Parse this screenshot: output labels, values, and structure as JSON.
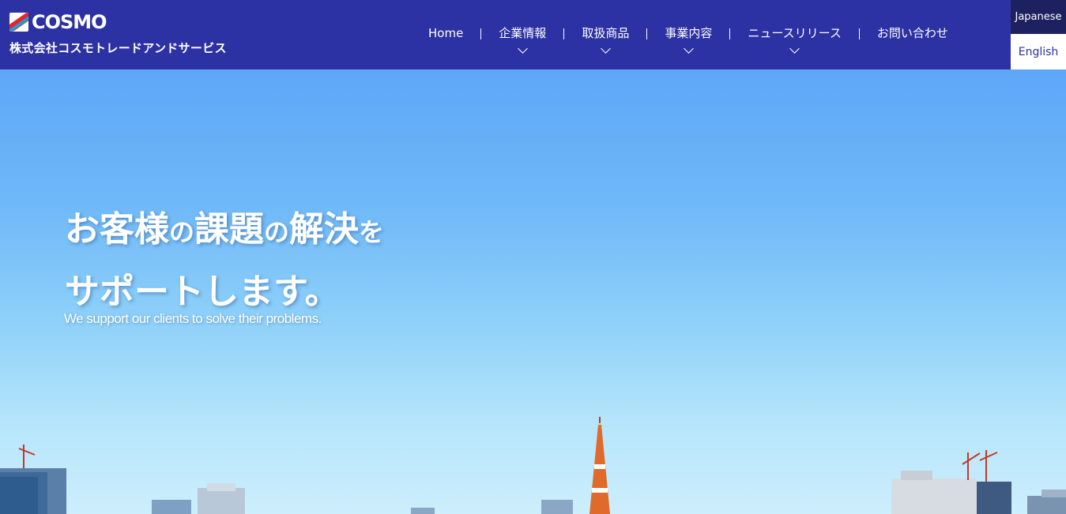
{
  "header": {
    "logo_text": "COSMO",
    "company_name": "株式会社コスモトレードアンドサービス",
    "brand_color": "#2c31a3"
  },
  "nav": {
    "items": [
      {
        "label": "Home",
        "has_dropdown": false
      },
      {
        "label": "企業情報",
        "has_dropdown": true
      },
      {
        "label": "取扱商品",
        "has_dropdown": true
      },
      {
        "label": "事業内容",
        "has_dropdown": true
      },
      {
        "label": "ニュースリリース",
        "has_dropdown": true
      },
      {
        "label": "お問い合わせ",
        "has_dropdown": false
      }
    ]
  },
  "language": {
    "japanese": "Japanese",
    "english": "English"
  },
  "hero": {
    "line1_parts": [
      "お客様",
      "の",
      "課題",
      "の",
      "解決",
      "を"
    ],
    "line2": "サポートします。",
    "subtitle": "We support our clients to solve their problems."
  },
  "icons": {
    "dropdown": "chevron-down-icon",
    "logo": "cosmo-logo-icon"
  }
}
